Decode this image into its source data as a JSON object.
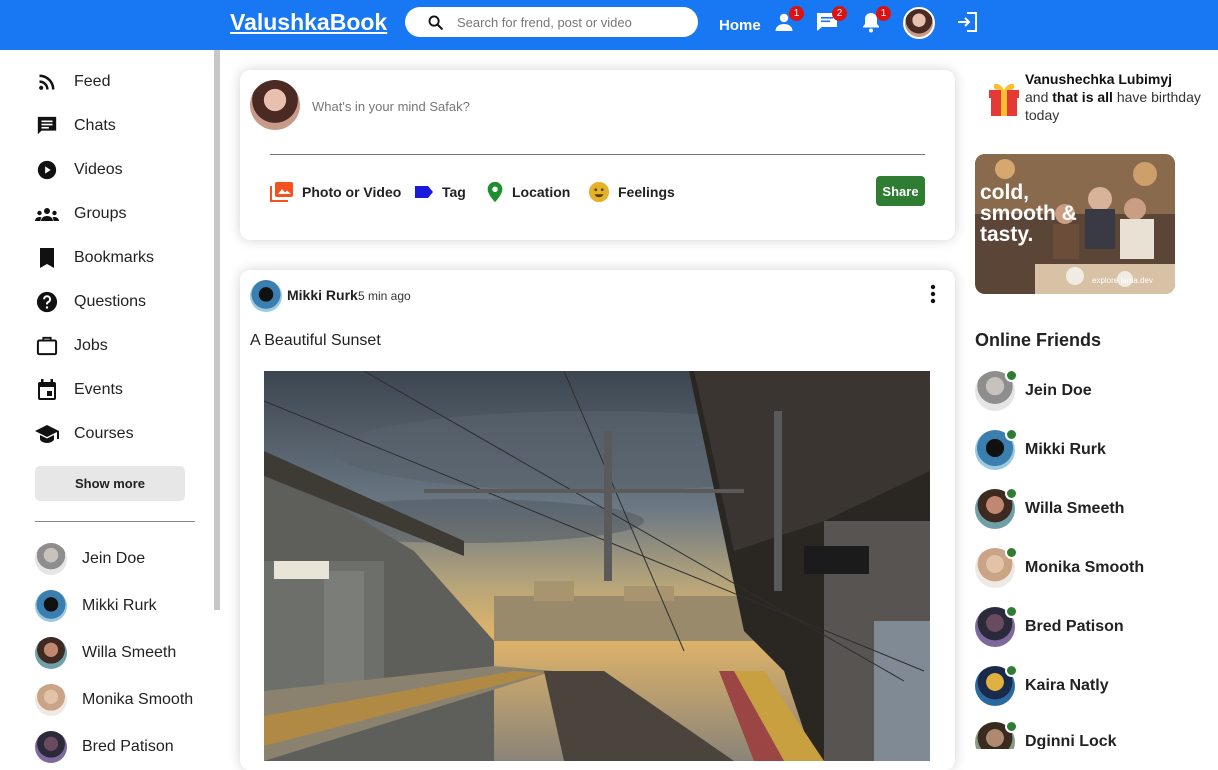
{
  "topbar": {
    "logo": "ValushkaBook",
    "search_placeholder": "Search for frend, post or video",
    "home_label": "Home",
    "badges": {
      "friends": "1",
      "chats": "2",
      "notifications": "1"
    },
    "accent": "#1877f2"
  },
  "sidebar": {
    "items": [
      {
        "label": "Feed",
        "icon": "rss-icon"
      },
      {
        "label": "Chats",
        "icon": "chat-icon"
      },
      {
        "label": "Videos",
        "icon": "play-circle-icon"
      },
      {
        "label": "Groups",
        "icon": "groups-icon"
      },
      {
        "label": "Bookmarks",
        "icon": "bookmark-icon"
      },
      {
        "label": "Questions",
        "icon": "help-icon"
      },
      {
        "label": "Jobs",
        "icon": "briefcase-icon"
      },
      {
        "label": "Events",
        "icon": "calendar-icon"
      },
      {
        "label": "Courses",
        "icon": "school-icon"
      }
    ],
    "show_more": "Show more",
    "friends": [
      "Jein Doe",
      "Mikki Rurk",
      "Willa Smeeth",
      "Monika Smooth",
      "Bred Patison"
    ]
  },
  "share": {
    "placeholder": "What's in your mind Safak?",
    "options": [
      "Photo or Video",
      "Tag",
      "Location",
      "Feelings"
    ],
    "button": "Share"
  },
  "post": {
    "user": "Mikki Rurk",
    "time": "5 min ago",
    "text": "A Beautiful Sunset"
  },
  "rightbar": {
    "birthday": {
      "name": "Vanushechka Lubimyj",
      "mid": "and",
      "bold": "that is all",
      "rest": "have birthday today"
    },
    "ad_text": "cold, smooth & tasty.",
    "ad_small": "explore lama.dev",
    "online_title": "Online Friends",
    "online": [
      "Jein Doe",
      "Mikki Rurk",
      "Willa Smeeth",
      "Monika Smooth",
      "Bred Patison",
      "Kaira Natly",
      "Dginni Lock"
    ],
    "online_color": "#2e7d32"
  }
}
